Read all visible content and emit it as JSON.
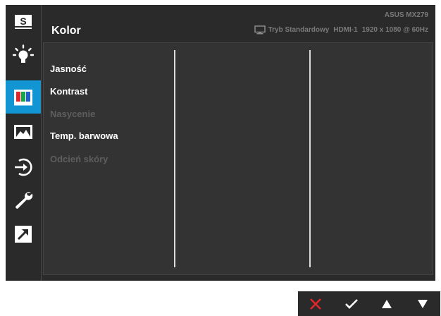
{
  "header": {
    "title": "Kolor",
    "model": "ASUS MX279",
    "mode": "Tryb Standardowy",
    "input": "HDMI-1",
    "resolution": "1920 x 1080 @ 60Hz"
  },
  "sidebar": {
    "items": [
      {
        "name": "splendid",
        "icon": "splendid-s-icon",
        "active": false
      },
      {
        "name": "blue-light",
        "icon": "bulb-icon",
        "active": false
      },
      {
        "name": "color",
        "icon": "color-bars-icon",
        "active": true
      },
      {
        "name": "image",
        "icon": "image-icon",
        "active": false
      },
      {
        "name": "input-select",
        "icon": "input-select-icon",
        "active": false
      },
      {
        "name": "system-setup",
        "icon": "wrench-icon",
        "active": false
      },
      {
        "name": "shortcut",
        "icon": "shortcut-arrow-icon",
        "active": false
      }
    ]
  },
  "menu": {
    "items": [
      {
        "label": "Jasność",
        "enabled": true
      },
      {
        "label": "Kontrast",
        "enabled": true
      },
      {
        "label": "Nasycenie",
        "enabled": false
      },
      {
        "label": "Temp. barwowa",
        "enabled": true
      },
      {
        "label": "Odcień skóry",
        "enabled": false
      }
    ]
  },
  "nav": {
    "buttons": [
      {
        "name": "close",
        "icon": "close-x-icon",
        "color": "#e0262a"
      },
      {
        "name": "confirm",
        "icon": "checkmark-icon",
        "color": "#ffffff"
      },
      {
        "name": "up",
        "icon": "triangle-up-icon",
        "color": "#ffffff"
      },
      {
        "name": "down",
        "icon": "triangle-down-icon",
        "color": "#ffffff"
      }
    ]
  },
  "colors": {
    "accent": "#1296d3",
    "background": "#2a2a2a",
    "disabled_text": "#5e5e5e"
  }
}
